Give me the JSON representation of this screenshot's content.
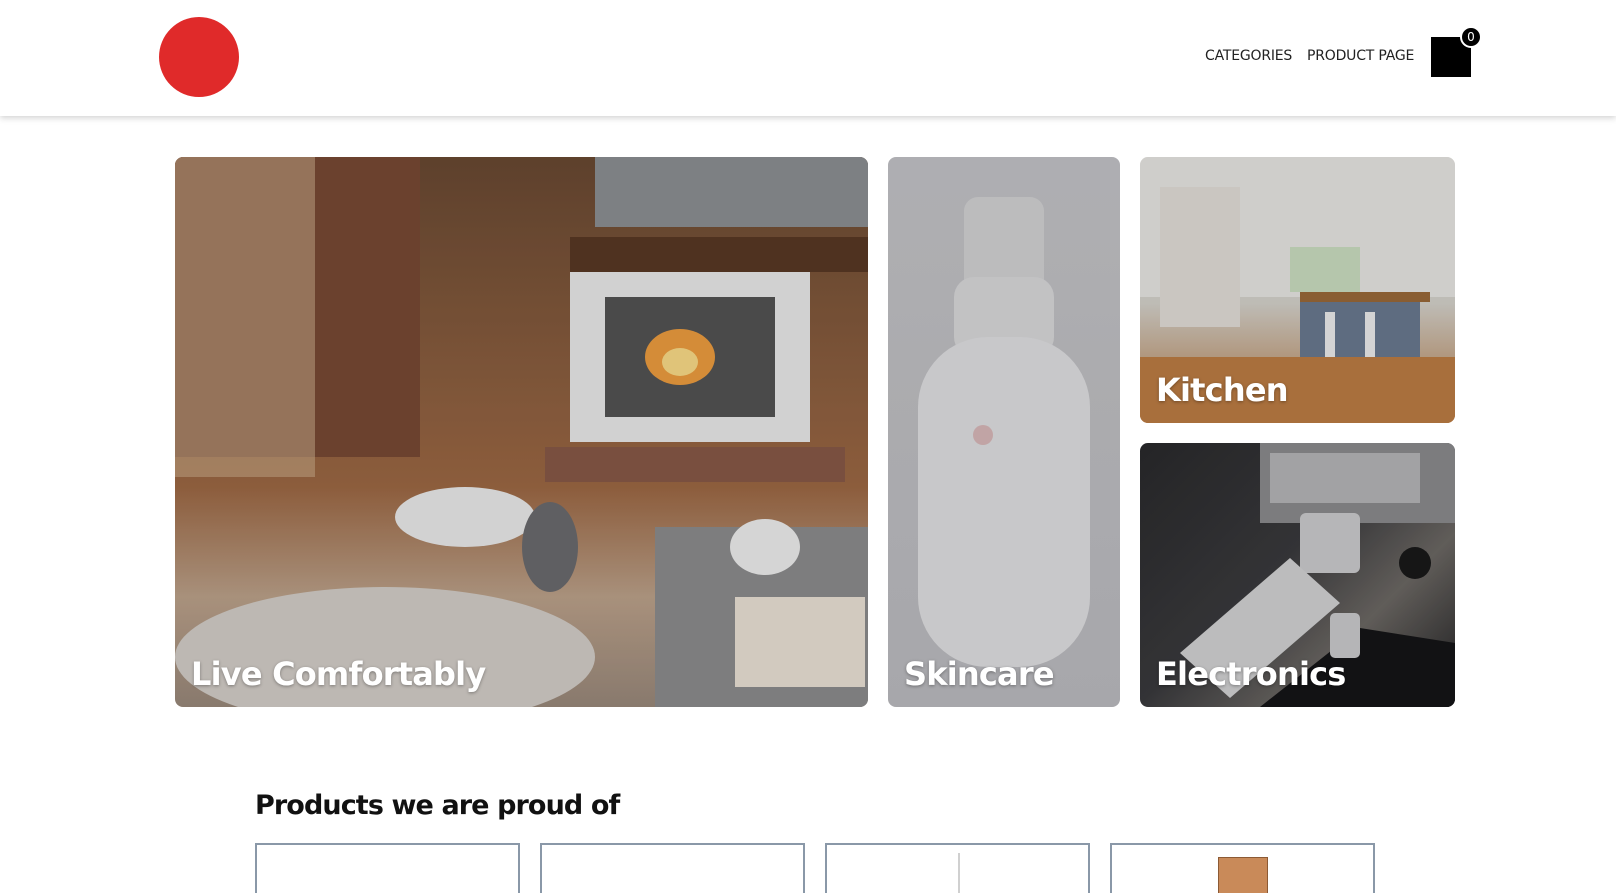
{
  "header": {
    "nav": {
      "categories": "CATEGORIES",
      "product_page": "PRODUCT PAGE"
    },
    "cart": {
      "count": "0"
    }
  },
  "hero": {
    "tiles": [
      {
        "label": "Live Comfortably"
      },
      {
        "label": "Skincare"
      },
      {
        "label": "Kitchen"
      },
      {
        "label": "Electronics"
      }
    ]
  },
  "featured": {
    "title": "Products we are proud of"
  },
  "colors": {
    "logo": "#e02a2a",
    "card_border": "#8a98a8"
  }
}
